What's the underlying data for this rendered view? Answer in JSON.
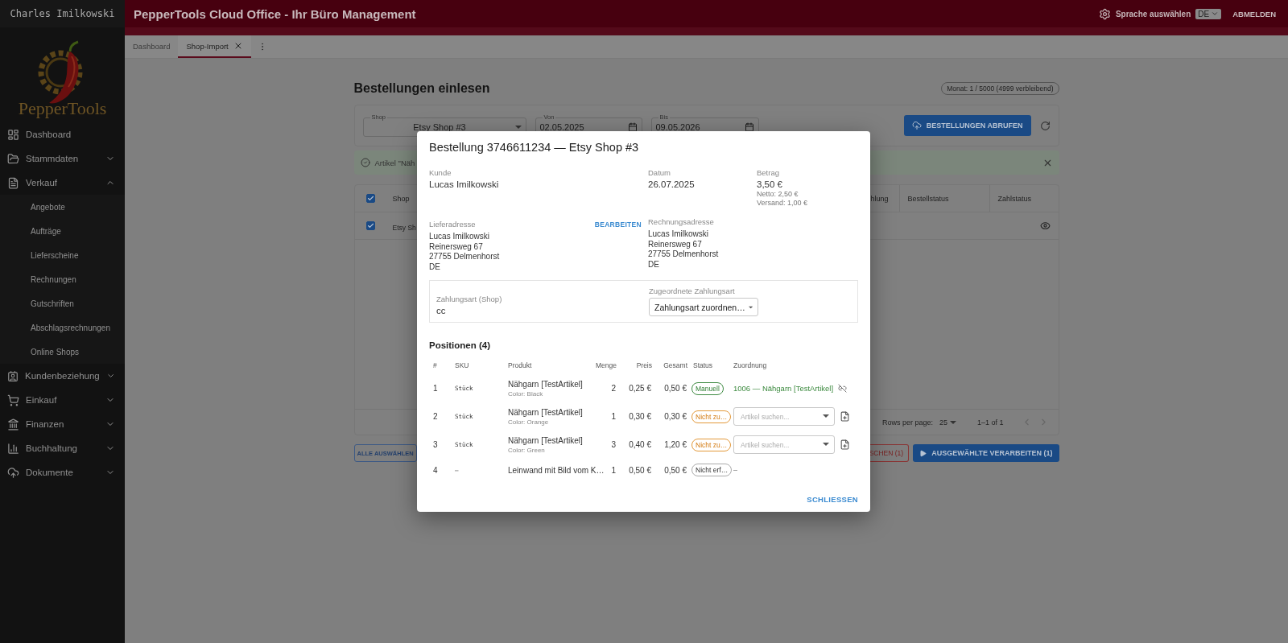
{
  "sidebar": {
    "user": "Charles Imilkowski",
    "brand": "PepperTools",
    "items": [
      {
        "label": "Dashboard"
      },
      {
        "label": "Stammdaten",
        "expanded": false
      },
      {
        "label": "Verkauf",
        "expanded": true,
        "children": [
          {
            "label": "Angebote"
          },
          {
            "label": "Aufträge"
          },
          {
            "label": "Lieferscheine"
          },
          {
            "label": "Rechnungen"
          },
          {
            "label": "Gutschriften"
          },
          {
            "label": "Abschlagsrechnungen"
          },
          {
            "label": "Online Shops"
          }
        ]
      },
      {
        "label": "Kundenbeziehung",
        "expanded": false
      },
      {
        "label": "Einkauf",
        "expanded": false
      },
      {
        "label": "Finanzen",
        "expanded": false
      },
      {
        "label": "Buchhaltung",
        "expanded": false
      },
      {
        "label": "Dokumente",
        "expanded": false
      }
    ]
  },
  "header": {
    "title": "PepperTools Cloud Office - Ihr Büro Management",
    "language_label": "Sprache auswählen",
    "language": "DE",
    "logout": "ABMELDEN"
  },
  "tabs": [
    {
      "label": "Dashboard",
      "selected": false,
      "closable": false
    },
    {
      "label": "Shop-Import",
      "selected": true,
      "closable": true
    }
  ],
  "page": {
    "title": "Bestellungen einlesen",
    "quota": "Monat: 1 / 5000 (4999 verbleibend)",
    "filters": {
      "shop": {
        "label": "Shop",
        "value": "Etsy Shop #3"
      },
      "from": {
        "label": "Von",
        "value": "02.05.2025"
      },
      "to": {
        "label": "Bis",
        "value": "09.05.2026"
      }
    },
    "fetch_button": "BESTELLUNGEN ABRUFEN",
    "alert": "Artikel \"Näh",
    "table": {
      "all_checked": true,
      "left_columns": [
        "Shop"
      ],
      "right_columns": [
        "hlung",
        "Bestellstatus",
        "Zahlstatus"
      ],
      "rows": [
        {
          "checked": true,
          "shop": "Etsy Sh"
        }
      ]
    },
    "pagination": {
      "rows_label": "Rows per page:",
      "rows": "25",
      "range": "1–1 of 1"
    },
    "select_all": "ALLE AUSWÄHLEN",
    "delete": "SCHEN (1)",
    "process": "AUSGEWÄHLTE VERARBEITEN (1)"
  },
  "dialog": {
    "title": "Bestellung 3746611234 — Etsy Shop #3",
    "customer": {
      "label": "Kunde",
      "value": "Lucas Imilkowski"
    },
    "date": {
      "label": "Datum",
      "value": "26.07.2025"
    },
    "amount": {
      "label": "Betrag",
      "value": "3,50 €",
      "net": "Netto: 2,50 €",
      "shipping": "Versand: 1,00 €"
    },
    "shipping_address": {
      "label": "Lieferadresse",
      "edit": "BEARBEITEN",
      "lines": [
        "Lucas Imilkowski",
        "Reinersweg 67",
        "27755 Delmenhorst",
        "DE"
      ]
    },
    "billing_address": {
      "label": "Rechnungsadresse",
      "lines": [
        "Lucas Imilkowski",
        "Reinersweg 67",
        "27755 Delmenhorst",
        "DE"
      ]
    },
    "payment": {
      "shop_label": "Zahlungsart (Shop)",
      "shop_value": "cc",
      "assigned_label": "Zugeordnete Zahlungsart",
      "assigned_value": "Zahlungsart zuordnen…"
    },
    "positions_title": "Positionen (4)",
    "columns": [
      "#",
      "SKU",
      "Produkt",
      "Menge",
      "Preis",
      "Gesamt",
      "Status",
      "Zuordnung"
    ],
    "rows": [
      {
        "index": "1",
        "sku": "Stück",
        "product": "Nähgarn [TestArtikel]",
        "variant": "Color: Black",
        "qty": "2",
        "price": "0,25 €",
        "total": "0,50 €",
        "status": {
          "label": "Manuell",
          "kind": "manual"
        },
        "assignment": {
          "kind": "linked",
          "text": "1006 — Nähgarn [TestArtikel]"
        }
      },
      {
        "index": "2",
        "sku": "Stück",
        "product": "Nähgarn [TestArtikel]",
        "variant": "Color: Orange",
        "qty": "1",
        "price": "0,30 €",
        "total": "0,30 €",
        "status": {
          "label": "Nicht zu…",
          "kind": "unassigned"
        },
        "assignment": {
          "kind": "search",
          "placeholder": "Artikel suchen..."
        }
      },
      {
        "index": "3",
        "sku": "Stück",
        "product": "Nähgarn [TestArtikel]",
        "variant": "Color: Green",
        "qty": "3",
        "price": "0,40 €",
        "total": "1,20 €",
        "status": {
          "label": "Nicht zu…",
          "kind": "unassigned"
        },
        "assignment": {
          "kind": "search",
          "placeholder": "Artikel suchen..."
        }
      },
      {
        "index": "4",
        "sku": "–",
        "product": "Leinwand mit Bild vom K…",
        "qty": "1",
        "price": "0,50 €",
        "total": "0,50 €",
        "status": {
          "label": "Nicht erf…",
          "kind": "unfulfilled"
        },
        "assignment": {
          "kind": "none",
          "text": "–"
        }
      }
    ],
    "close": "SCHLIESSEN"
  }
}
